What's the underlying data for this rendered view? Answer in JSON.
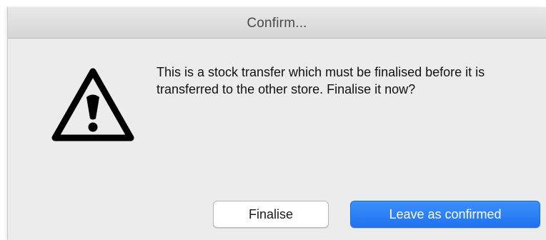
{
  "dialog": {
    "title": "Confirm...",
    "icon": "warning-icon",
    "message": "This is a stock transfer which must be finalised before it is transferred to the other store. Finalise it now?",
    "buttons": {
      "finalise_label": "Finalise",
      "leave_label": "Leave as confirmed"
    },
    "colors": {
      "primary_button": "#2a7cf5",
      "titlebar": "#dcdcdc",
      "background": "#ececec"
    }
  }
}
